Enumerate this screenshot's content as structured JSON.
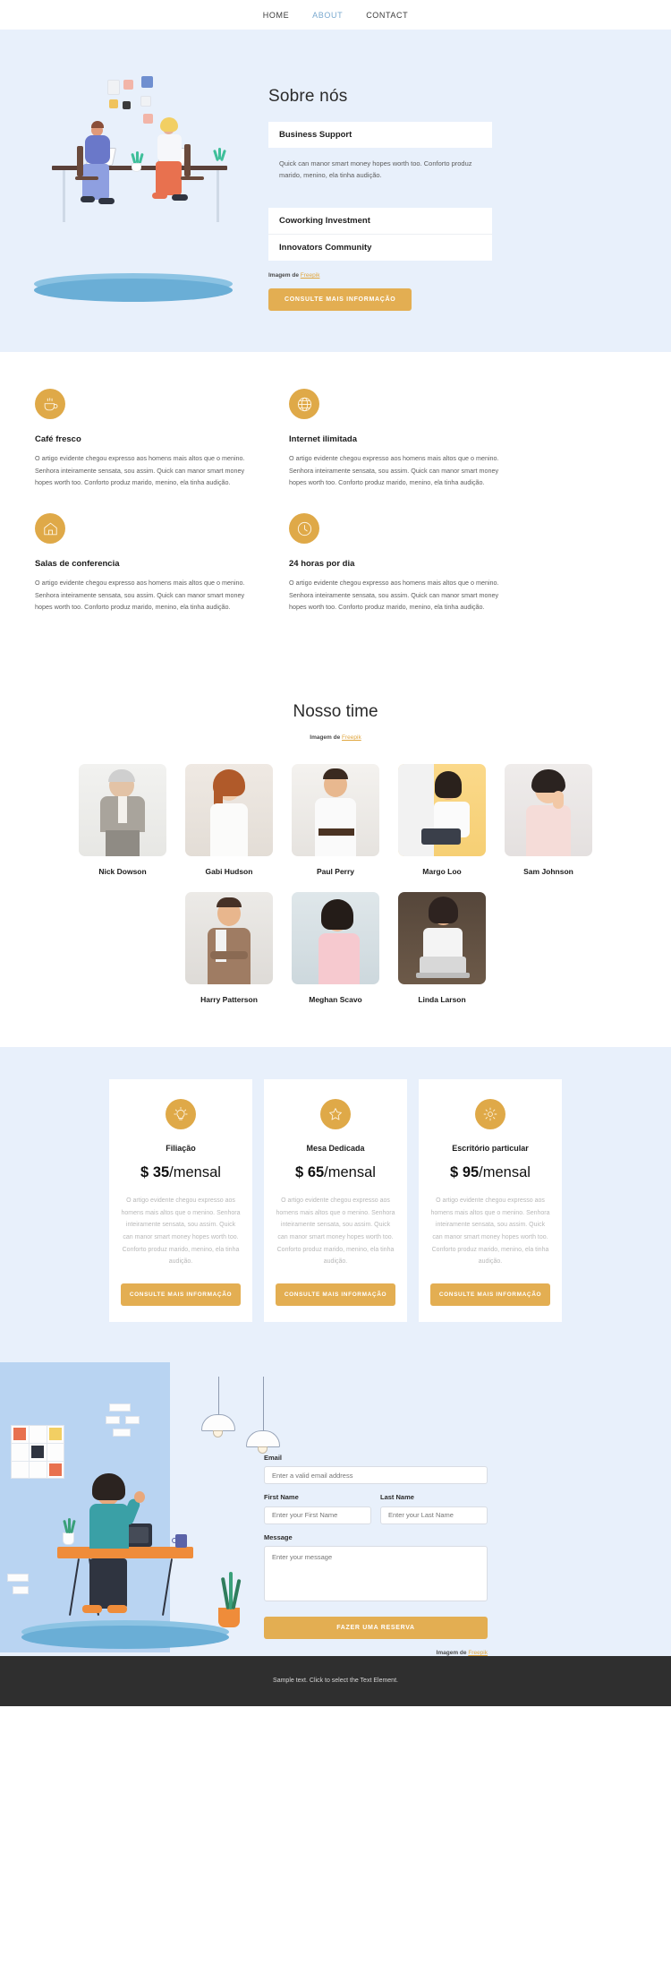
{
  "nav": {
    "items": [
      {
        "label": "HOME",
        "active": false
      },
      {
        "label": "ABOUT",
        "active": true
      },
      {
        "label": "CONTACT",
        "active": false
      }
    ]
  },
  "hero": {
    "title": "Sobre nós",
    "accordion": [
      {
        "title": "Business Support",
        "body": "Quick can manor smart money hopes worth too. Conforto produz marido, menino, ela tinha audição."
      },
      {
        "title": "Coworking Investment",
        "body": ""
      },
      {
        "title": "Innovators Community",
        "body": ""
      }
    ],
    "credit_prefix": "Imagem de ",
    "credit_link": "Freepik",
    "cta_label": "CONSULTE MAIS INFORMAÇÃO"
  },
  "features": [
    {
      "icon": "coffee-cup-icon",
      "title": "Café fresco",
      "body": "O artigo evidente chegou expresso aos homens mais altos que o menino. Senhora inteiramente sensata, sou assim. Quick can manor smart money hopes worth too. Conforto produz marido, menino, ela tinha audição."
    },
    {
      "icon": "globe-icon",
      "title": "Internet ilimitada",
      "body": "O artigo evidente chegou expresso aos homens mais altos que o menino. Senhora inteiramente sensata, sou assim. Quick can manor smart money hopes worth too. Conforto produz marido, menino, ela tinha audição."
    },
    {
      "icon": "home-icon",
      "title": "Salas de conferencia",
      "body": "O artigo evidente chegou expresso aos homens mais altos que o menino. Senhora inteiramente sensata, sou assim. Quick can manor smart money hopes worth too. Conforto produz marido, menino, ela tinha audição."
    },
    {
      "icon": "clock-icon",
      "title": "24 horas por dia",
      "body": "O artigo evidente chegou expresso aos homens mais altos que o menino. Senhora inteiramente sensata, sou assim. Quick can manor smart money hopes worth too. Conforto produz marido, menino, ela tinha audição."
    }
  ],
  "team": {
    "title": "Nosso time",
    "credit_prefix": "Imagem de ",
    "credit_link": "Freepik",
    "members": [
      {
        "name": "Nick Dowson"
      },
      {
        "name": "Gabi Hudson"
      },
      {
        "name": "Paul Perry"
      },
      {
        "name": "Margo Loo"
      },
      {
        "name": "Sam Johnson"
      },
      {
        "name": "Harry Patterson"
      },
      {
        "name": "Meghan Scavo"
      },
      {
        "name": "Linda Larson"
      }
    ]
  },
  "pricing": {
    "cards": [
      {
        "icon": "lightbulb-icon",
        "name": "Filiação",
        "currency": "$",
        "amount": "35",
        "period": "/mensal",
        "desc": "O artigo evidente chegou expresso aos homens mais altos que o menino. Senhora inteiramente sensata, sou assim. Quick can manor smart money hopes worth too. Conforto produz marido, menino, ela tinha audição.",
        "button": "CONSULTE MAIS INFORMAÇÃO"
      },
      {
        "icon": "star-icon",
        "name": "Mesa Dedicada",
        "currency": "$",
        "amount": "65",
        "period": "/mensal",
        "desc": "O artigo evidente chegou expresso aos homens mais altos que o menino. Senhora inteiramente sensata, sou assim. Quick can manor smart money hopes worth too. Conforto produz marido, menino, ela tinha audição.",
        "button": "CONSULTE MAIS INFORMAÇÃO"
      },
      {
        "icon": "gear-icon",
        "name": "Escritório particular",
        "currency": "$",
        "amount": "95",
        "period": "/mensal",
        "desc": "O artigo evidente chegou expresso aos homens mais altos que o menino. Senhora inteiramente sensata, sou assim. Quick can manor smart money hopes worth too. Conforto produz marido, menino, ela tinha audição.",
        "button": "CONSULTE MAIS INFORMAÇÃO"
      }
    ]
  },
  "contact": {
    "email_label": "Email",
    "email_placeholder": "Enter a valid email address",
    "first_name_label": "First Name",
    "first_name_placeholder": "Enter your First Name",
    "last_name_label": "Last Name",
    "last_name_placeholder": "Enter your Last Name",
    "message_label": "Message",
    "message_placeholder": "Enter your message",
    "submit_label": "FAZER UMA RESERVA",
    "credit_prefix": "Imagem de ",
    "credit_link": "Freepik"
  },
  "footer": {
    "text": "Sample text. Click to select the Text Element."
  },
  "colors": {
    "accent_gold": "#e3ae52",
    "light_blue_bg": "#e8f0fb",
    "nav_active": "#7aa9cf",
    "footer_bg": "#2f2f2f"
  }
}
